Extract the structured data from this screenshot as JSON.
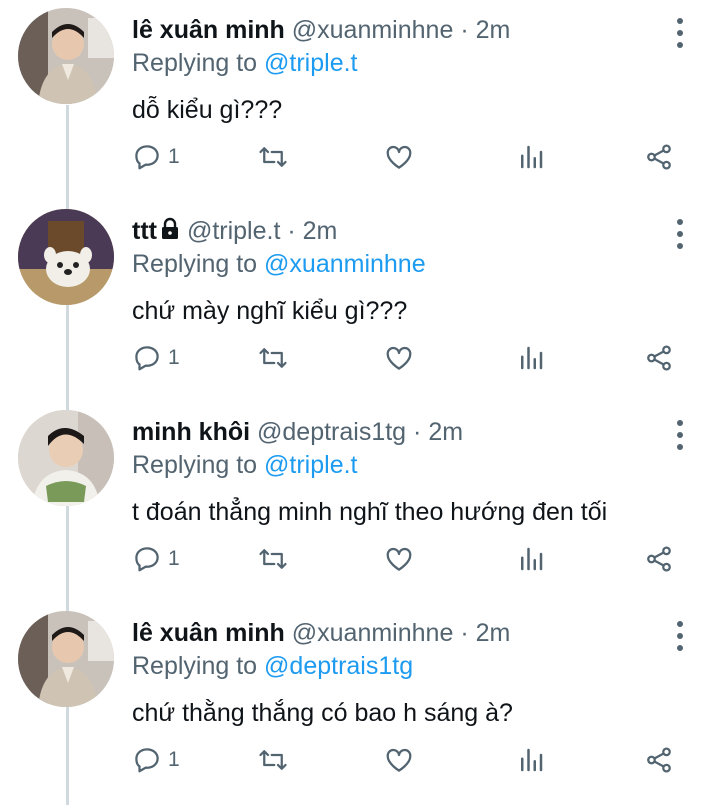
{
  "tweets": [
    {
      "name": "lê xuân minh",
      "handle": "@xuanminhne",
      "dot": "·",
      "time": "2m",
      "replying_prefix": "Replying to ",
      "replying_to": "@triple.t",
      "text": "dỗ kiểu gì???",
      "reply_count": "1",
      "avatar": "person-photo"
    },
    {
      "name": "ttt",
      "handle": "@triple.t",
      "dot": "·",
      "time": "2m",
      "replying_prefix": "Replying to ",
      "replying_to": "@xuanminhne",
      "text": "chứ mày nghĩ kiểu gì???",
      "reply_count": "1",
      "avatar": "dog-plush",
      "locked": true
    },
    {
      "name": "minh khôi",
      "handle": "@deptrais1tg",
      "dot": "·",
      "time": "2m",
      "replying_prefix": "Replying to ",
      "replying_to": "@triple.t",
      "text": "t đoán thẳng minh nghĩ theo hướng đen tối",
      "reply_count": "1",
      "avatar": "person-photo"
    },
    {
      "name": "lê xuân minh",
      "handle": "@xuanminhne",
      "dot": "·",
      "time": "2m",
      "replying_prefix": "Replying to ",
      "replying_to": "@deptrais1tg",
      "text": "chứ thằng thắng có bao h sáng à?",
      "reply_count": "1",
      "avatar": "person-photo"
    }
  ],
  "icons": {
    "reply": "reply-icon",
    "retweet": "retweet-icon",
    "like": "heart-icon",
    "analytics": "analytics-icon",
    "share": "share-icon",
    "more": "more-vertical-icon",
    "lock": "lock-icon"
  },
  "colors": {
    "mention": "#1d9bf0",
    "secondary_text": "#536471",
    "icon": "#536471",
    "thread_line": "#cfd9de"
  }
}
